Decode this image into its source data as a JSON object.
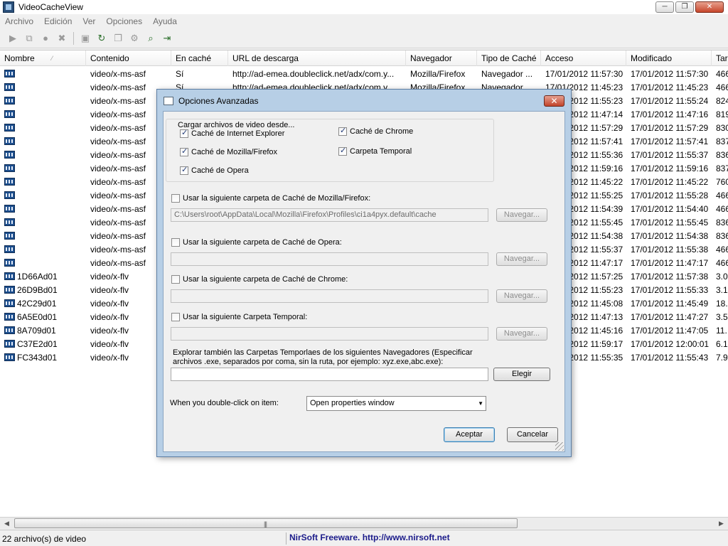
{
  "window": {
    "title": "VideoCacheView",
    "minimize": "─",
    "maximize": "❐",
    "close": "✕"
  },
  "menu": [
    "Archivo",
    "Edición",
    "Ver",
    "Opciones",
    "Ayuda"
  ],
  "toolbar": [
    {
      "name": "play-icon",
      "glyph": "▶"
    },
    {
      "name": "copy-files-icon",
      "glyph": "⧉"
    },
    {
      "name": "record-icon",
      "glyph": "●"
    },
    {
      "name": "delete-icon",
      "glyph": "✖"
    },
    {
      "name": "save-icon",
      "glyph": "▣"
    },
    {
      "name": "refresh-icon",
      "glyph": "↻"
    },
    {
      "name": "copy-icon",
      "glyph": "❐"
    },
    {
      "name": "properties-icon",
      "glyph": "⚙"
    },
    {
      "name": "find-icon",
      "glyph": "⌕"
    },
    {
      "name": "exit-icon",
      "glyph": "⇥"
    }
  ],
  "columns": [
    {
      "label": "Nombre"
    },
    {
      "label": "Contenido"
    },
    {
      "label": "En caché"
    },
    {
      "label": "URL de descarga"
    },
    {
      "label": "Navegador"
    },
    {
      "label": "Tipo de Caché"
    },
    {
      "label": "Acceso"
    },
    {
      "label": "Modificado"
    },
    {
      "label": "Tar"
    }
  ],
  "rows": [
    [
      "",
      "video/x-ms-asf",
      "Sí",
      "http://ad-emea.doubleclick.net/adx/com.y...",
      "Mozilla/Firefox",
      "Navegador ...",
      "17/01/2012 11:57:30",
      "17/01/2012 11:57:30",
      "466"
    ],
    [
      "",
      "video/x-ms-asf",
      "Sí",
      "http://ad-emea.doubleclick.net/adx/com.y...",
      "Mozilla/Firefox",
      "Navegador ...",
      "17/01/2012 11:45:23",
      "17/01/2012 11:45:23",
      "466"
    ],
    [
      "",
      "video/x-ms-asf",
      "",
      "",
      "",
      "",
      "17/01/2012 11:55:23",
      "17/01/2012 11:55:24",
      "824"
    ],
    [
      "",
      "video/x-ms-asf",
      "",
      "",
      "",
      "",
      "17/01/2012 11:47:14",
      "17/01/2012 11:47:16",
      "819"
    ],
    [
      "",
      "video/x-ms-asf",
      "",
      "",
      "",
      "",
      "17/01/2012 11:57:29",
      "17/01/2012 11:57:29",
      "830"
    ],
    [
      "",
      "video/x-ms-asf",
      "",
      "",
      "",
      "",
      "17/01/2012 11:57:41",
      "17/01/2012 11:57:41",
      "837"
    ],
    [
      "",
      "video/x-ms-asf",
      "",
      "",
      "",
      "",
      "17/01/2012 11:55:36",
      "17/01/2012 11:55:37",
      "836"
    ],
    [
      "",
      "video/x-ms-asf",
      "",
      "",
      "",
      "",
      "17/01/2012 11:59:16",
      "17/01/2012 11:59:16",
      "837"
    ],
    [
      "",
      "video/x-ms-asf",
      "",
      "",
      "",
      "",
      "17/01/2012 11:45:22",
      "17/01/2012 11:45:22",
      "760"
    ],
    [
      "",
      "video/x-ms-asf",
      "",
      "",
      "",
      "",
      "17/01/2012 11:55:25",
      "17/01/2012 11:55:28",
      "466"
    ],
    [
      "",
      "video/x-ms-asf",
      "",
      "",
      "",
      "",
      "17/01/2012 11:54:39",
      "17/01/2012 11:54:40",
      "466"
    ],
    [
      "",
      "video/x-ms-asf",
      "",
      "",
      "",
      "",
      "17/01/2012 11:55:45",
      "17/01/2012 11:55:45",
      "836"
    ],
    [
      "",
      "video/x-ms-asf",
      "",
      "",
      "",
      "",
      "17/01/2012 11:54:38",
      "17/01/2012 11:54:38",
      "836"
    ],
    [
      "",
      "video/x-ms-asf",
      "",
      "",
      "",
      "",
      "17/01/2012 11:55:37",
      "17/01/2012 11:55:38",
      "466"
    ],
    [
      "",
      "video/x-ms-asf",
      "",
      "",
      "",
      "",
      "17/01/2012 11:47:17",
      "17/01/2012 11:47:17",
      "466"
    ],
    [
      "1D66Ad01",
      "video/x-flv",
      "",
      "",
      "",
      "",
      "17/01/2012 11:57:25",
      "17/01/2012 11:57:38",
      "3.0"
    ],
    [
      "26D9Bd01",
      "video/x-flv",
      "",
      "",
      "",
      "",
      "17/01/2012 11:55:23",
      "17/01/2012 11:55:33",
      "3.1"
    ],
    [
      "42C29d01",
      "video/x-flv",
      "",
      "",
      "",
      "",
      "17/01/2012 11:45:08",
      "17/01/2012 11:45:49",
      "18."
    ],
    [
      "6A5E0d01",
      "video/x-flv",
      "",
      "",
      "",
      "",
      "17/01/2012 11:47:13",
      "17/01/2012 11:47:27",
      "3.5"
    ],
    [
      "8A709d01",
      "video/x-flv",
      "",
      "",
      "",
      "",
      "17/01/2012 11:45:16",
      "17/01/2012 11:47:05",
      "11."
    ],
    [
      "C37E2d01",
      "video/x-flv",
      "",
      "",
      "",
      "",
      "17/01/2012 11:59:17",
      "17/01/2012 12:00:01",
      "6.1"
    ],
    [
      "FC343d01",
      "video/x-flv",
      "",
      "",
      "",
      "",
      "17/01/2012 11:55:35",
      "17/01/2012 11:55:43",
      "7.9"
    ]
  ],
  "statusbar": {
    "count": "22 archivo(s) de video",
    "link": "NirSoft Freeware.  http://www.nirsoft.net"
  },
  "dialog": {
    "title": "Opciones Avanzadas",
    "close": "✕",
    "group_title": "Cargar archivos de video desde...",
    "sources": [
      {
        "label": "Caché de Internet Explorer",
        "checked": true
      },
      {
        "label": "Caché de Chrome",
        "checked": true
      },
      {
        "label": "Caché de Mozilla/Firefox",
        "checked": true
      },
      {
        "label": "Carpeta Temporal",
        "checked": true
      },
      {
        "label": "Caché de Opera",
        "checked": true
      }
    ],
    "firefox": {
      "label": "Usar la siguiente carpeta de Caché de Mozilla/Firefox:",
      "checked": false,
      "path": "C:\\Users\\root\\AppData\\Local\\Mozilla\\Firefox\\Profiles\\ci1a4pyx.default\\cache",
      "browse": "Navegar..."
    },
    "opera": {
      "label": "Usar la siguiente carpeta de Caché de Opera:",
      "checked": false,
      "path": "",
      "browse": "Navegar..."
    },
    "chrome": {
      "label": "Usar la siguiente carpeta de Caché de Chrome:",
      "checked": false,
      "path": "",
      "browse": "Navegar..."
    },
    "temp": {
      "label": "Usar la siguiente Carpeta Temporal:",
      "checked": false,
      "path": "",
      "browse": "Navegar..."
    },
    "explore_label_1": "Explorar también las Carpetas Temporlaes de los siguientes Navegadores (Especificar",
    "explore_label_2": "archivos .exe, separados por coma, sin la ruta, por ejemplo: xyz.exe,abc.exe):",
    "explore_value": "",
    "choose": "Elegir",
    "dblclick_label": "When you double-click on item:",
    "dblclick_value": "Open properties window",
    "accept": "Aceptar",
    "cancel": "Cancelar"
  }
}
